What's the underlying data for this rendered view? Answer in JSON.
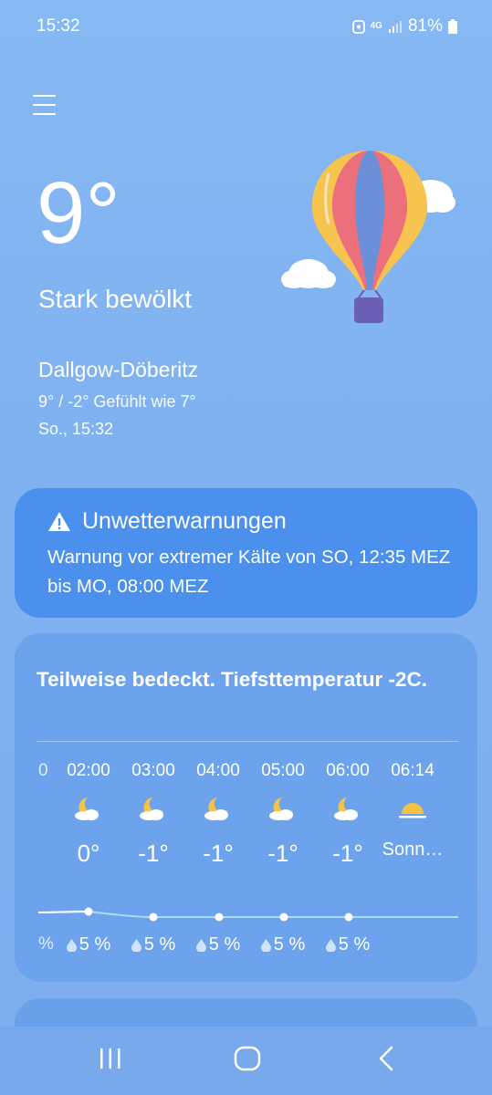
{
  "status": {
    "time": "15:32",
    "network": "4G",
    "battery": "81%"
  },
  "current": {
    "temperature": "9°",
    "condition": "Stark bewölkt",
    "location": "Dallgow-Döberitz",
    "feels_like": "9° / -2° Gefühlt wie 7°",
    "datetime": "So., 15:32"
  },
  "warning": {
    "title": "Unwetterwarnungen",
    "text": "Warnung vor extremer Kälte von SO, 12:35 MEZ bis MO, 08:00 MEZ"
  },
  "forecast": {
    "summary": "Teilweise bedeckt. Tiefsttemperatur -2C.",
    "left_fragment_time": "0",
    "left_fragment_precip": "%",
    "hours": [
      {
        "time": "02:00",
        "icon": "moon-cloud-icon",
        "temp": "0°",
        "precip": "5 %"
      },
      {
        "time": "03:00",
        "icon": "moon-cloud-icon",
        "temp": "-1°",
        "precip": "5 %"
      },
      {
        "time": "04:00",
        "icon": "moon-cloud-icon",
        "temp": "-1°",
        "precip": "5 %"
      },
      {
        "time": "05:00",
        "icon": "moon-cloud-icon",
        "temp": "-1°",
        "precip": "5 %"
      },
      {
        "time": "06:00",
        "icon": "moon-cloud-icon",
        "temp": "-1°",
        "precip": "5 %"
      },
      {
        "time": "06:14",
        "icon": "sunrise-icon",
        "temp": "Sonn…",
        "precip": ""
      }
    ]
  }
}
